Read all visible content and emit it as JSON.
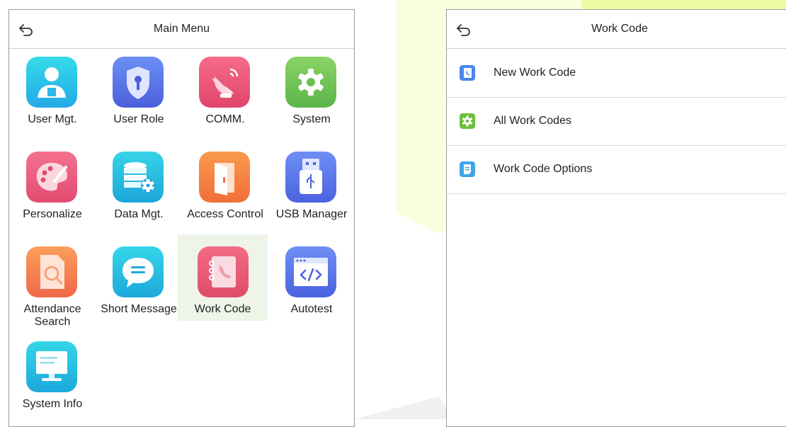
{
  "left_panel": {
    "title": "Main Menu",
    "tiles": [
      {
        "label": "User Mgt.",
        "icon": "user-icon"
      },
      {
        "label": "User Role",
        "icon": "shield-key-icon"
      },
      {
        "label": "COMM.",
        "icon": "satellite-dish-icon"
      },
      {
        "label": "System",
        "icon": "gear-icon"
      },
      {
        "label": "Personalize",
        "icon": "palette-icon"
      },
      {
        "label": "Data Mgt.",
        "icon": "database-gear-icon"
      },
      {
        "label": "Access Control",
        "icon": "door-icon"
      },
      {
        "label": "USB Manager",
        "icon": "usb-drive-icon"
      },
      {
        "label": "Attendance Search",
        "icon": "document-search-icon"
      },
      {
        "label": "Short Message",
        "icon": "chat-bubble-icon"
      },
      {
        "label": "Work Code",
        "icon": "phone-book-icon",
        "selected": true
      },
      {
        "label": "Autotest",
        "icon": "code-window-icon"
      },
      {
        "label": "System Info",
        "icon": "monitor-icon"
      }
    ]
  },
  "right_panel": {
    "title": "Work Code",
    "items": [
      {
        "label": "New Work Code",
        "icon": "phone-book-small-icon",
        "color": "#4a86e8"
      },
      {
        "label": "All Work Codes",
        "icon": "gear-small-icon",
        "color": "#6cbf3c"
      },
      {
        "label": "Work Code Options",
        "icon": "note-icon",
        "color": "#3fa5e8"
      }
    ]
  },
  "colors": {
    "selected_tile_bg": "#eef4e7",
    "watermark": "#c8f000"
  }
}
